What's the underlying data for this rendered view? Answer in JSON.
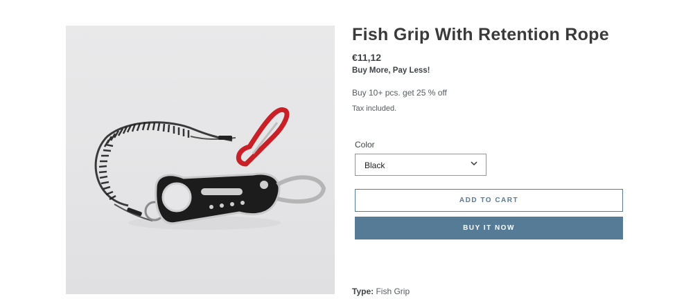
{
  "product": {
    "title": "Fish Grip With Retention Rope",
    "price": "€11,12",
    "promo_title": "Buy More, Pay Less!",
    "promo_text": "Buy 10+ pcs. get 25 % off",
    "tax_note": "Tax included.",
    "image_icon": "product-photo-fish-grip"
  },
  "options": {
    "color_label": "Color",
    "color_selected": "Black"
  },
  "buttons": {
    "add_to_cart": "ADD TO CART",
    "buy_now": "BUY IT NOW"
  },
  "meta": {
    "type_label": "Type:",
    "type_value": "Fish Grip"
  },
  "colors": {
    "accent": "#557b97",
    "text": "#3d4246"
  }
}
